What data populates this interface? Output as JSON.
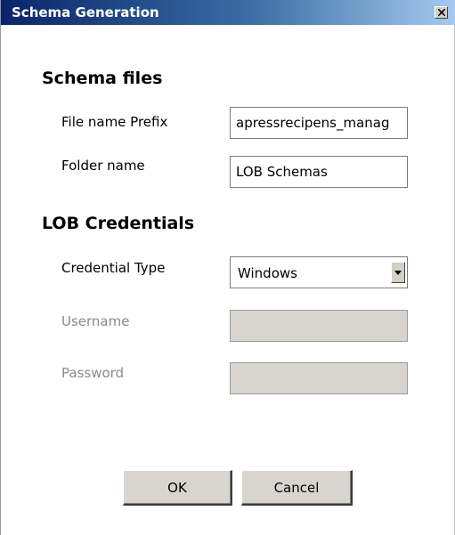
{
  "window": {
    "title": "Schema Generation",
    "close_icon": "close-icon"
  },
  "schema_files": {
    "heading": "Schema files",
    "file_name_prefix": {
      "label": "File name Prefix",
      "value": "apressrecipens_manag"
    },
    "folder_name": {
      "label": "Folder name",
      "value": "LOB Schemas"
    }
  },
  "lob_credentials": {
    "heading": "LOB Credentials",
    "credential_type": {
      "label": "Credential Type",
      "value": "Windows",
      "dropdown_icon": "chevron-down-icon"
    },
    "username": {
      "label": "Username",
      "value": "",
      "disabled": true
    },
    "password": {
      "label": "Password",
      "value": "",
      "disabled": true
    }
  },
  "buttons": {
    "ok": "OK",
    "cancel": "Cancel"
  },
  "colors": {
    "titlebar_start": "#0a246a",
    "titlebar_end": "#a6caf0",
    "disabled_field": "#d8d5d0",
    "disabled_text": "#8a8a8a",
    "button_face": "#d8d5d0"
  }
}
